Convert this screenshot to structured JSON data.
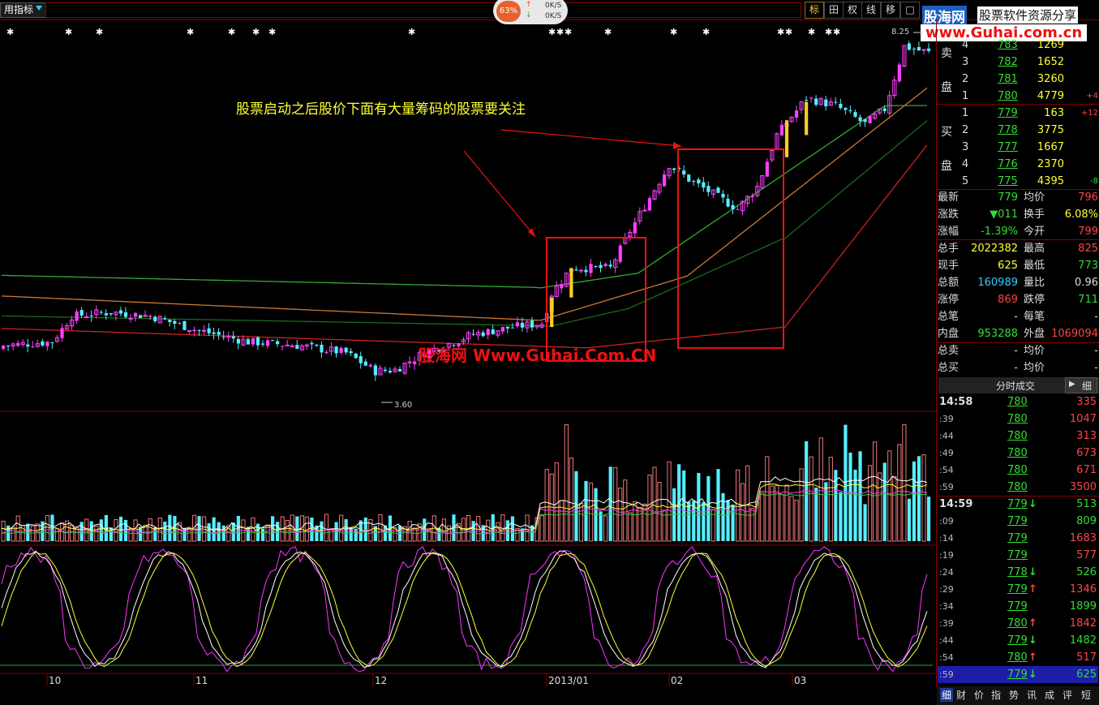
{
  "toolbar": {
    "indicator_label": "用指标",
    "buttons": [
      "标",
      "田",
      "权",
      "线",
      "移",
      "□"
    ],
    "speed_pct": "63%",
    "speed_up": "0K/S",
    "speed_down": "0K/S"
  },
  "banner": {
    "site_name": "股海网",
    "tagline": "股票软件资源分享",
    "url": "www.Guhai.com.cn"
  },
  "chart": {
    "annotation": "股票启动之后股价下面有大量筹码的股票要关注",
    "watermark": "股海网 Www.Guhai.Com.CN",
    "low_label": "3.60",
    "high_label": "8.25",
    "x_labels": [
      "10",
      "11",
      "12",
      "2013/01",
      "02",
      "03"
    ]
  },
  "colors": {
    "up_candle": "#ff3fff",
    "down_candle": "#5ef",
    "ma_green": "#3a3",
    "ma_orange": "#c73",
    "ma_red": "#c22",
    "annotation_box": "#e11"
  },
  "sell_book": {
    "label_a": "卖",
    "label_b": "盘",
    "rows": [
      {
        "level": "4",
        "price": "783",
        "vol": "1269",
        "delta": ""
      },
      {
        "level": "3",
        "price": "782",
        "vol": "1652",
        "delta": ""
      },
      {
        "level": "2",
        "price": "781",
        "vol": "3260",
        "delta": ""
      },
      {
        "level": "1",
        "price": "780",
        "vol": "4779",
        "delta": "+4"
      }
    ]
  },
  "buy_book": {
    "label_a": "买",
    "label_b": "盘",
    "rows": [
      {
        "level": "1",
        "price": "779",
        "vol": "163",
        "delta": "+12"
      },
      {
        "level": "2",
        "price": "778",
        "vol": "3775",
        "delta": ""
      },
      {
        "level": "3",
        "price": "777",
        "vol": "1667",
        "delta": ""
      },
      {
        "level": "4",
        "price": "776",
        "vol": "2370",
        "delta": ""
      },
      {
        "level": "5",
        "price": "775",
        "vol": "4395",
        "delta": "-8"
      }
    ]
  },
  "stats": [
    {
      "k1": "最新",
      "v1": "779",
      "c1": "g",
      "k2": "均价",
      "v2": "796",
      "c2": "r"
    },
    {
      "k1": "涨跌",
      "v1": "▼011",
      "c1": "g",
      "k2": "换手",
      "v2": "6.08%",
      "c2": "y"
    },
    {
      "k1": "涨幅",
      "v1": "-1.39%",
      "c1": "g",
      "k2": "今开",
      "v2": "799",
      "c2": "r"
    },
    {
      "k1": "总手",
      "v1": "2022382",
      "c1": "y",
      "k2": "最高",
      "v2": "825",
      "c2": "r"
    },
    {
      "k1": "现手",
      "v1": "625",
      "c1": "y",
      "k2": "最低",
      "v2": "773",
      "c2": "g"
    },
    {
      "k1": "总额",
      "v1": "160989",
      "c1": "c",
      "k2": "量比",
      "v2": "0.96",
      "c2": "w"
    },
    {
      "k1": "涨停",
      "v1": "869",
      "c1": "r",
      "k2": "跌停",
      "v2": "711",
      "c2": "g"
    },
    {
      "k1": "总笔",
      "v1": "-",
      "c1": "w",
      "k2": "每笔",
      "v2": "-",
      "c2": "w"
    },
    {
      "k1": "内盘",
      "v1": "953288",
      "c1": "g",
      "k2": "外盘",
      "v2": "1069094",
      "c2": "r"
    },
    {
      "k1": "总卖",
      "v1": "-",
      "c1": "w",
      "k2": "均价",
      "v2": "-",
      "c2": "w"
    },
    {
      "k1": "总买",
      "v1": "-",
      "c1": "w",
      "k2": "均价",
      "v2": "-",
      "c2": "w"
    }
  ],
  "ticks": {
    "header": "分时成交",
    "detail_btn": "细",
    "rows": [
      {
        "time": "14:58",
        "price": "780",
        "arrow": "",
        "vol": "335",
        "vc": "r"
      },
      {
        "time": ":39",
        "price": "780",
        "arrow": "",
        "vol": "1047",
        "vc": "r"
      },
      {
        "time": ":44",
        "price": "780",
        "arrow": "",
        "vol": "313",
        "vc": "r"
      },
      {
        "time": ":49",
        "price": "780",
        "arrow": "",
        "vol": "673",
        "vc": "r"
      },
      {
        "time": ":54",
        "price": "780",
        "arrow": "",
        "vol": "671",
        "vc": "r"
      },
      {
        "time": ":59",
        "price": "780",
        "arrow": "",
        "vol": "3500",
        "vc": "r"
      },
      {
        "time": "14:59",
        "price": "779",
        "arrow": "↓",
        "vol": "513",
        "vc": "g"
      },
      {
        "time": ":09",
        "price": "779",
        "arrow": "",
        "vol": "809",
        "vc": "g"
      },
      {
        "time": ":14",
        "price": "779",
        "arrow": "",
        "vol": "1683",
        "vc": "r"
      },
      {
        "time": ":19",
        "price": "779",
        "arrow": "",
        "vol": "577",
        "vc": "r"
      },
      {
        "time": ":24",
        "price": "778",
        "arrow": "↓",
        "vol": "526",
        "vc": "g"
      },
      {
        "time": ":29",
        "price": "779",
        "arrow": "↑",
        "vol": "1346",
        "vc": "r"
      },
      {
        "time": ":34",
        "price": "779",
        "arrow": "",
        "vol": "1899",
        "vc": "g"
      },
      {
        "time": ":39",
        "price": "780",
        "arrow": "↑",
        "vol": "1842",
        "vc": "r"
      },
      {
        "time": ":44",
        "price": "779",
        "arrow": "↓",
        "vol": "1482",
        "vc": "g"
      },
      {
        "time": ":54",
        "price": "780",
        "arrow": "↑",
        "vol": "517",
        "vc": "r"
      },
      {
        "time": ":59",
        "price": "779",
        "arrow": "↓",
        "vol": "625",
        "vc": "g"
      }
    ]
  },
  "bottom_tabs": [
    "细",
    "财",
    "价",
    "指",
    "势",
    "讯",
    "成",
    "评",
    "短"
  ]
}
